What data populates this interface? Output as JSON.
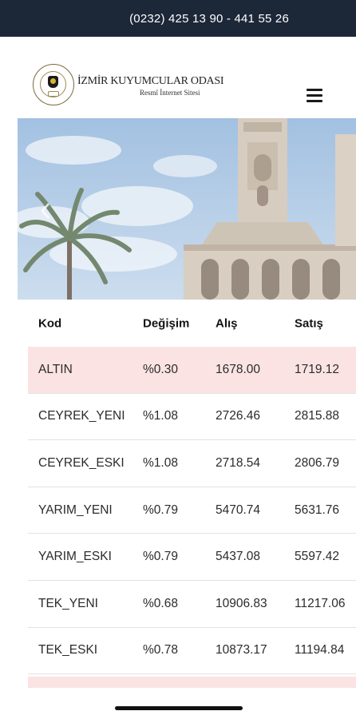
{
  "topbar": {
    "phone": "(0232) 425 13 90 - 441 55 26"
  },
  "header": {
    "logo_title": "İZMİR KUYUMCULAR ODASI",
    "logo_subtitle": "Resmî İnternet Sitesi"
  },
  "table": {
    "headers": [
      "Kod",
      "Değişim",
      "Alış",
      "Satış"
    ],
    "rows": [
      [
        "ALTIN",
        "%0.30",
        "1678.00",
        "1719.12"
      ],
      [
        "CEYREK_YENI",
        "%1.08",
        "2726.46",
        "2815.88"
      ],
      [
        "CEYREK_ESKI",
        "%1.08",
        "2718.54",
        "2806.79"
      ],
      [
        "YARIM_YENI",
        "%0.79",
        "5470.74",
        "5631.76"
      ],
      [
        "YARIM_ESKI",
        "%0.79",
        "5437.08",
        "5597.42"
      ],
      [
        "TEK_YENI",
        "%0.68",
        "10906.83",
        "11217.06"
      ],
      [
        "TEK_ESKI",
        "%0.78",
        "10873.17",
        "11194.84"
      ]
    ]
  },
  "colors": {
    "topbar_bg": "#1c2738",
    "highlight_row": "#fbe3e3"
  },
  "icons": {
    "menu": "hamburger-menu-icon",
    "carousel_prev": "chevron-left-icon"
  }
}
